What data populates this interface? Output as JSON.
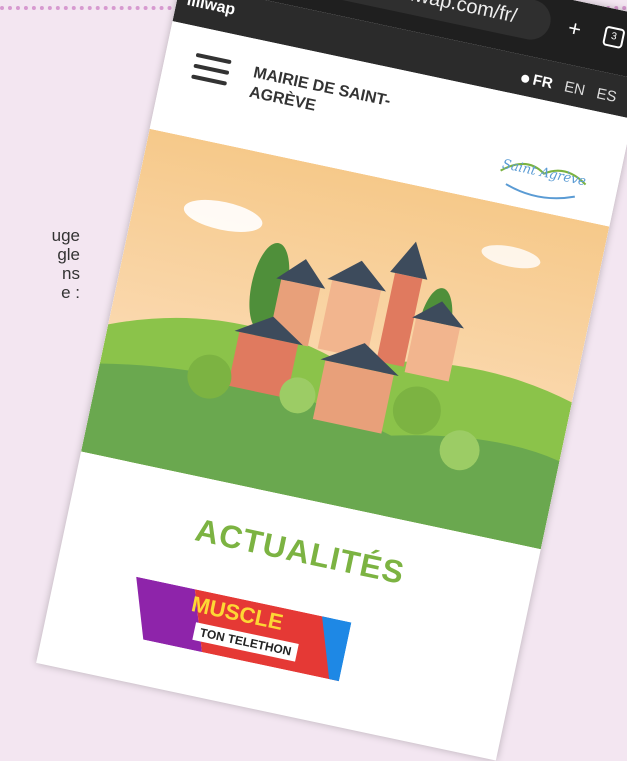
{
  "side_text": [
    "uge",
    "gle",
    "ns",
    "e :"
  ],
  "browser": {
    "url": "station.illiwap.com/fr/",
    "plus_icon": "+",
    "tabs_icon": "3"
  },
  "brand": "illiwap",
  "languages": {
    "active": "FR",
    "others": [
      "EN",
      "ES"
    ]
  },
  "site": {
    "title": "MAIRIE DE SAINT-AGRÈVE",
    "logo_text": "Saint Agrève"
  },
  "section_title": "ACTUALITÉS",
  "news": {
    "banner_line1": "MUSCLE",
    "banner_line2": "TON TELETHON"
  },
  "colors": {
    "accent_green": "#7cb342",
    "page_bg": "#f3e6f1",
    "browser_dark": "#1f1f1f"
  }
}
